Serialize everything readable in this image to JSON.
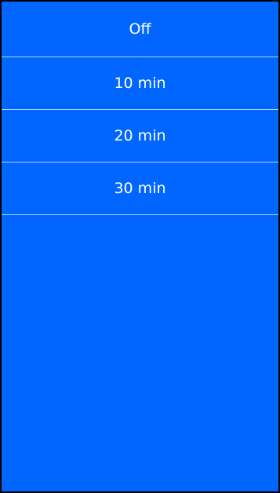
{
  "options_list": {
    "items": [
      {
        "label": "Off"
      },
      {
        "label": "10 min"
      },
      {
        "label": "20 min"
      },
      {
        "label": "30 min"
      }
    ]
  },
  "colors": {
    "background": "#0066ff",
    "text": "#ffffff",
    "divider": "#b9cdf5",
    "border": "#000000"
  }
}
